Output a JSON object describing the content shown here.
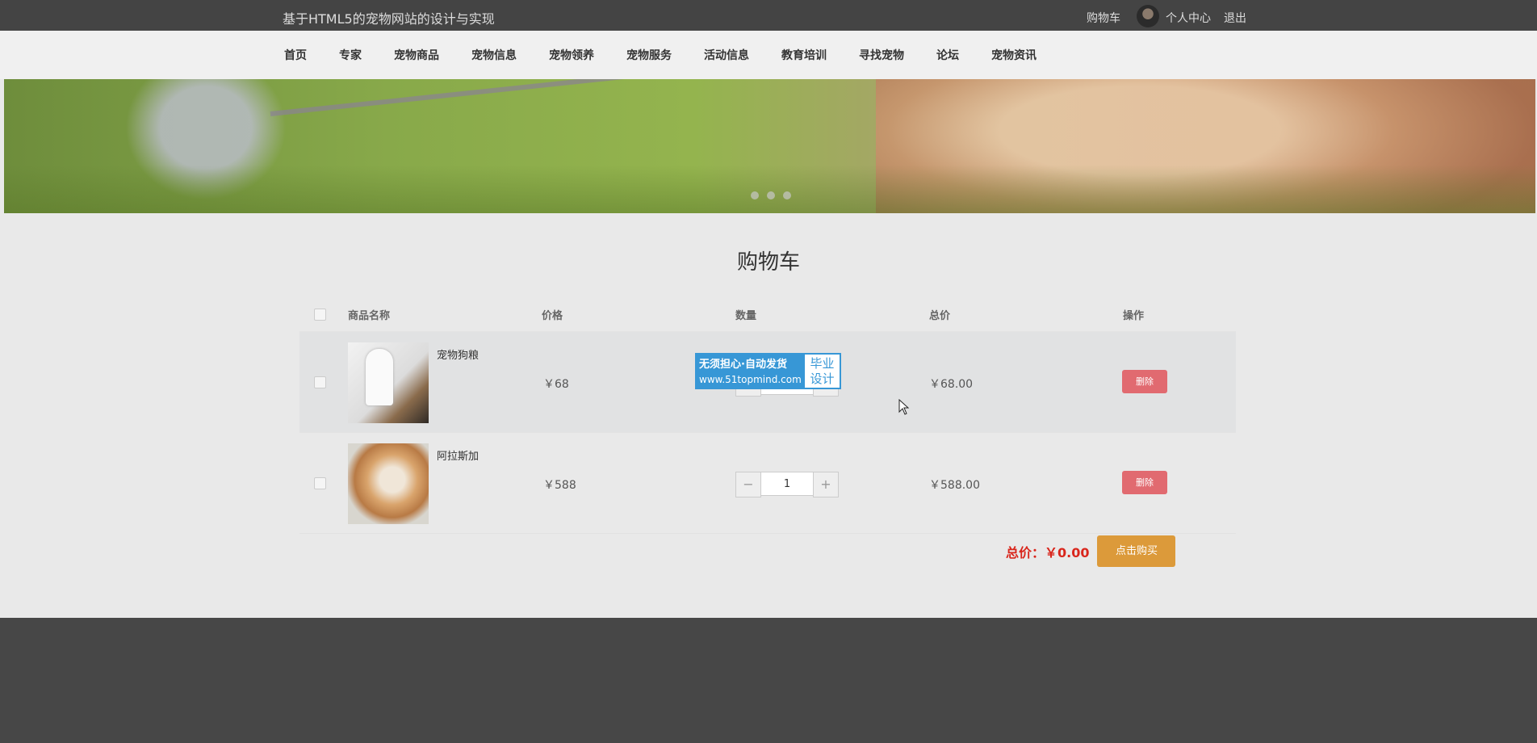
{
  "header": {
    "site_title": "基于HTML5的宠物网站的设计与实现",
    "cart_link": "购物车",
    "profile_link": "个人中心",
    "logout_link": "退出"
  },
  "nav": {
    "items": [
      "首页",
      "专家",
      "宠物商品",
      "宠物信息",
      "宠物领养",
      "宠物服务",
      "活动信息",
      "教育培训",
      "寻找宠物",
      "论坛",
      "宠物资讯"
    ]
  },
  "banner": {
    "slide_count": 3
  },
  "cart": {
    "title": "购物车",
    "columns": {
      "name": "商品名称",
      "price": "价格",
      "qty": "数量",
      "subtotal": "总价",
      "action": "操作"
    },
    "items": [
      {
        "name": "宠物狗粮",
        "price": "￥68",
        "qty": "1",
        "subtotal": "￥68.00",
        "delete_label": "删除"
      },
      {
        "name": "阿拉斯加",
        "price": "￥588",
        "qty": "1",
        "subtotal": "￥588.00",
        "delete_label": "删除"
      }
    ],
    "total_label": "总价：￥0.00",
    "buy_label": "点击购买",
    "qty_minus": "−",
    "qty_plus": "+"
  },
  "watermark": {
    "line1": "无须担心·自动发货",
    "line2": "www.51topmind.com",
    "right1": "毕业",
    "right2": "设计"
  },
  "colors": {
    "topbar": "#444444",
    "delete_button": "#e16a70",
    "buy_button": "#dc9a3a",
    "total_text": "#d9261c",
    "watermark_blue": "#3797d6"
  }
}
